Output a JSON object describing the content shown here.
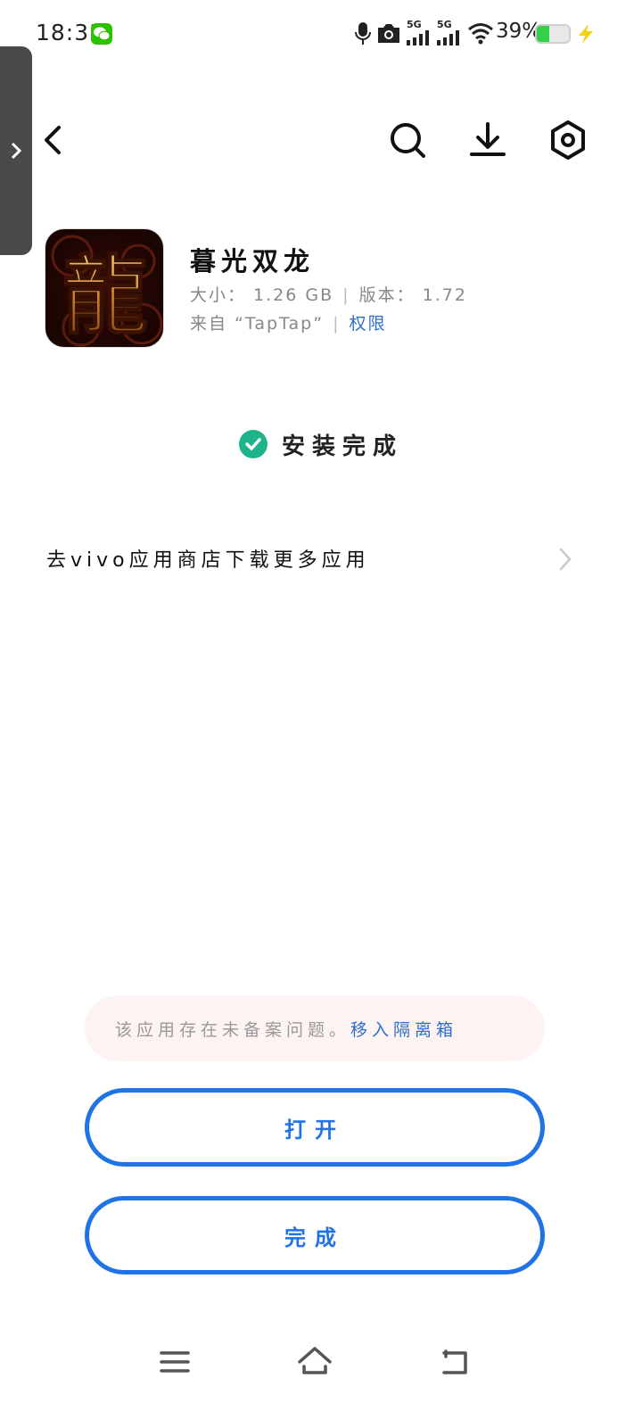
{
  "status_bar": {
    "time": "18:33",
    "network_1": "5G",
    "network_2": "5G",
    "battery_percent": "39%",
    "battery_level": 0.39,
    "icons": [
      "wechat-icon",
      "mic-icon",
      "camera-icon",
      "signal-icon",
      "signal-icon",
      "wifi-icon",
      "battery-icon",
      "charging-icon"
    ]
  },
  "top_bar": {
    "icons": [
      "back-icon",
      "search-icon",
      "download-icon",
      "settings-icon"
    ]
  },
  "app": {
    "name": "暮光双龙",
    "size": "大小： 1.26 GB",
    "version": "版本： 1.72",
    "source": "来自 “TapTap”",
    "permission_label": "权限",
    "icon_glyph": "龍"
  },
  "install": {
    "status": "安装完成"
  },
  "store_row": {
    "label": "去vivo应用商店下载更多应用"
  },
  "notice": {
    "text": "该应用存在未备案问题。",
    "link": "移入隔离箱"
  },
  "buttons": {
    "open": "打开",
    "done": "完成"
  },
  "colors": {
    "accent_blue": "#1f73e6",
    "link_blue": "#2f6fc9",
    "success_green": "#1fb38c",
    "notice_bg": "#fdf3f2"
  }
}
